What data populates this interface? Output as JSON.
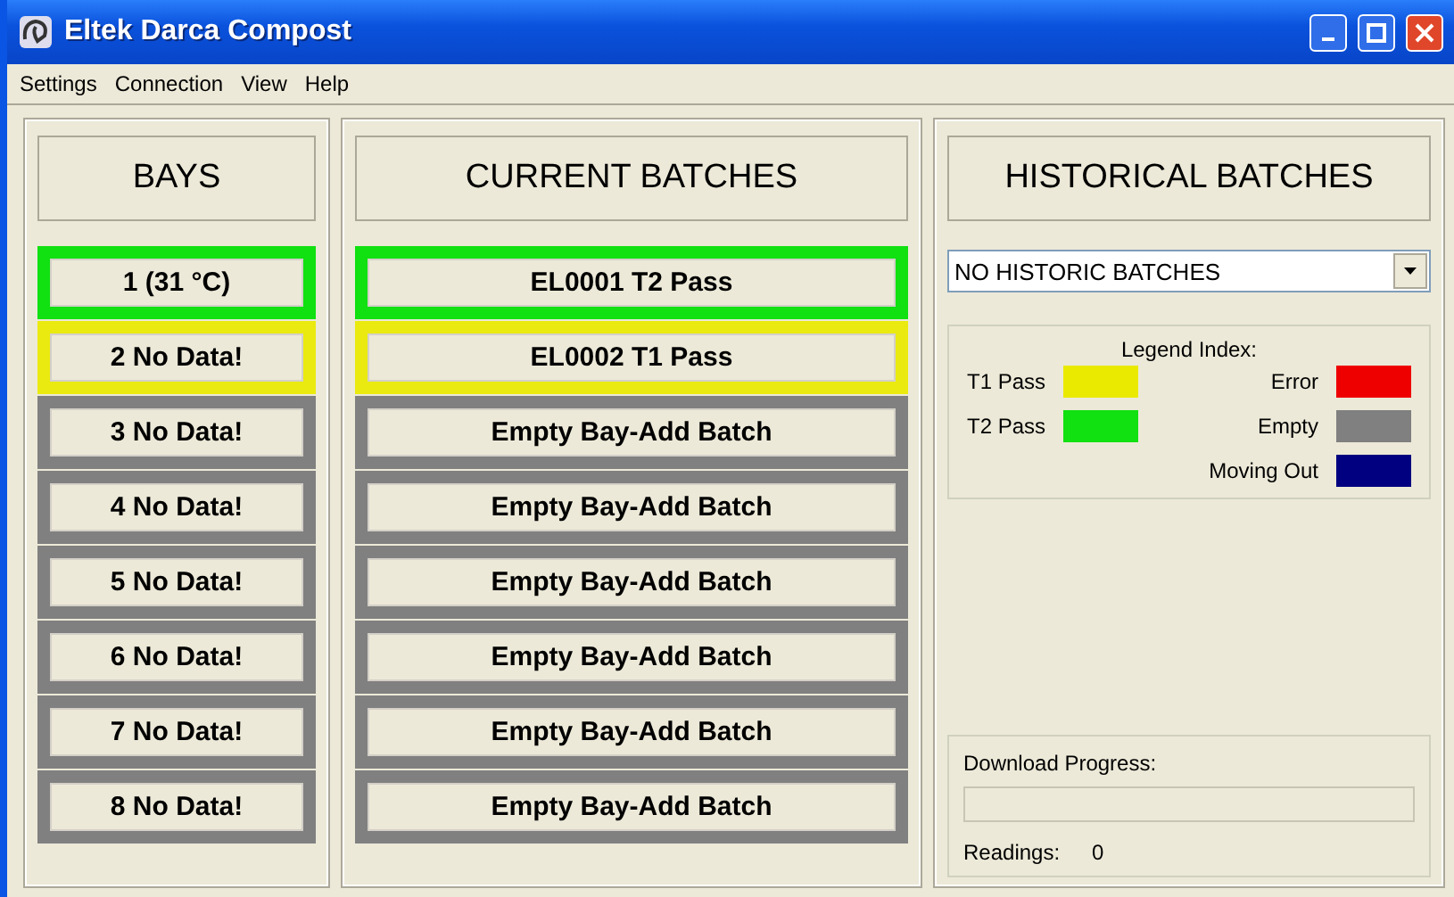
{
  "window": {
    "title": "Eltek Darca Compost"
  },
  "menu": [
    "Settings",
    "Connection",
    "View",
    "Help"
  ],
  "bays": {
    "heading": "BAYS",
    "items": [
      {
        "label": "1 (31 °C)",
        "color": "#11e011"
      },
      {
        "label": "2 No Data!",
        "color": "#eaea10"
      },
      {
        "label": "3 No Data!",
        "color": "#808080"
      },
      {
        "label": "4 No Data!",
        "color": "#808080"
      },
      {
        "label": "5 No Data!",
        "color": "#808080"
      },
      {
        "label": "6 No Data!",
        "color": "#808080"
      },
      {
        "label": "7 No Data!",
        "color": "#808080"
      },
      {
        "label": "8 No Data!",
        "color": "#808080"
      }
    ]
  },
  "current_batches": {
    "heading": "CURRENT BATCHES",
    "items": [
      {
        "label": "EL0001 T2 Pass",
        "color": "#11e011"
      },
      {
        "label": "EL0002 T1 Pass",
        "color": "#eaea10"
      },
      {
        "label": "Empty Bay-Add Batch",
        "color": "#808080"
      },
      {
        "label": "Empty Bay-Add Batch",
        "color": "#808080"
      },
      {
        "label": "Empty Bay-Add Batch",
        "color": "#808080"
      },
      {
        "label": "Empty Bay-Add Batch",
        "color": "#808080"
      },
      {
        "label": "Empty Bay-Add Batch",
        "color": "#808080"
      },
      {
        "label": "Empty Bay-Add Batch",
        "color": "#808080"
      }
    ]
  },
  "historical_batches": {
    "heading": "HISTORICAL BATCHES",
    "dropdown": {
      "value": "NO HISTORIC BATCHES"
    },
    "legend": {
      "title": "Legend Index:",
      "items": [
        {
          "label": "T1 Pass",
          "color": "#eaea00"
        },
        {
          "label": "Error",
          "color": "#ee0000"
        },
        {
          "label": "T2 Pass",
          "color": "#11e011"
        },
        {
          "label": "Empty",
          "color": "#808080"
        },
        {
          "label": "Moving Out",
          "color": "#000080"
        }
      ]
    },
    "download": {
      "label": "Download Progress:",
      "level": 0,
      "readings_label": "Readings:",
      "readings_value": "0"
    }
  }
}
